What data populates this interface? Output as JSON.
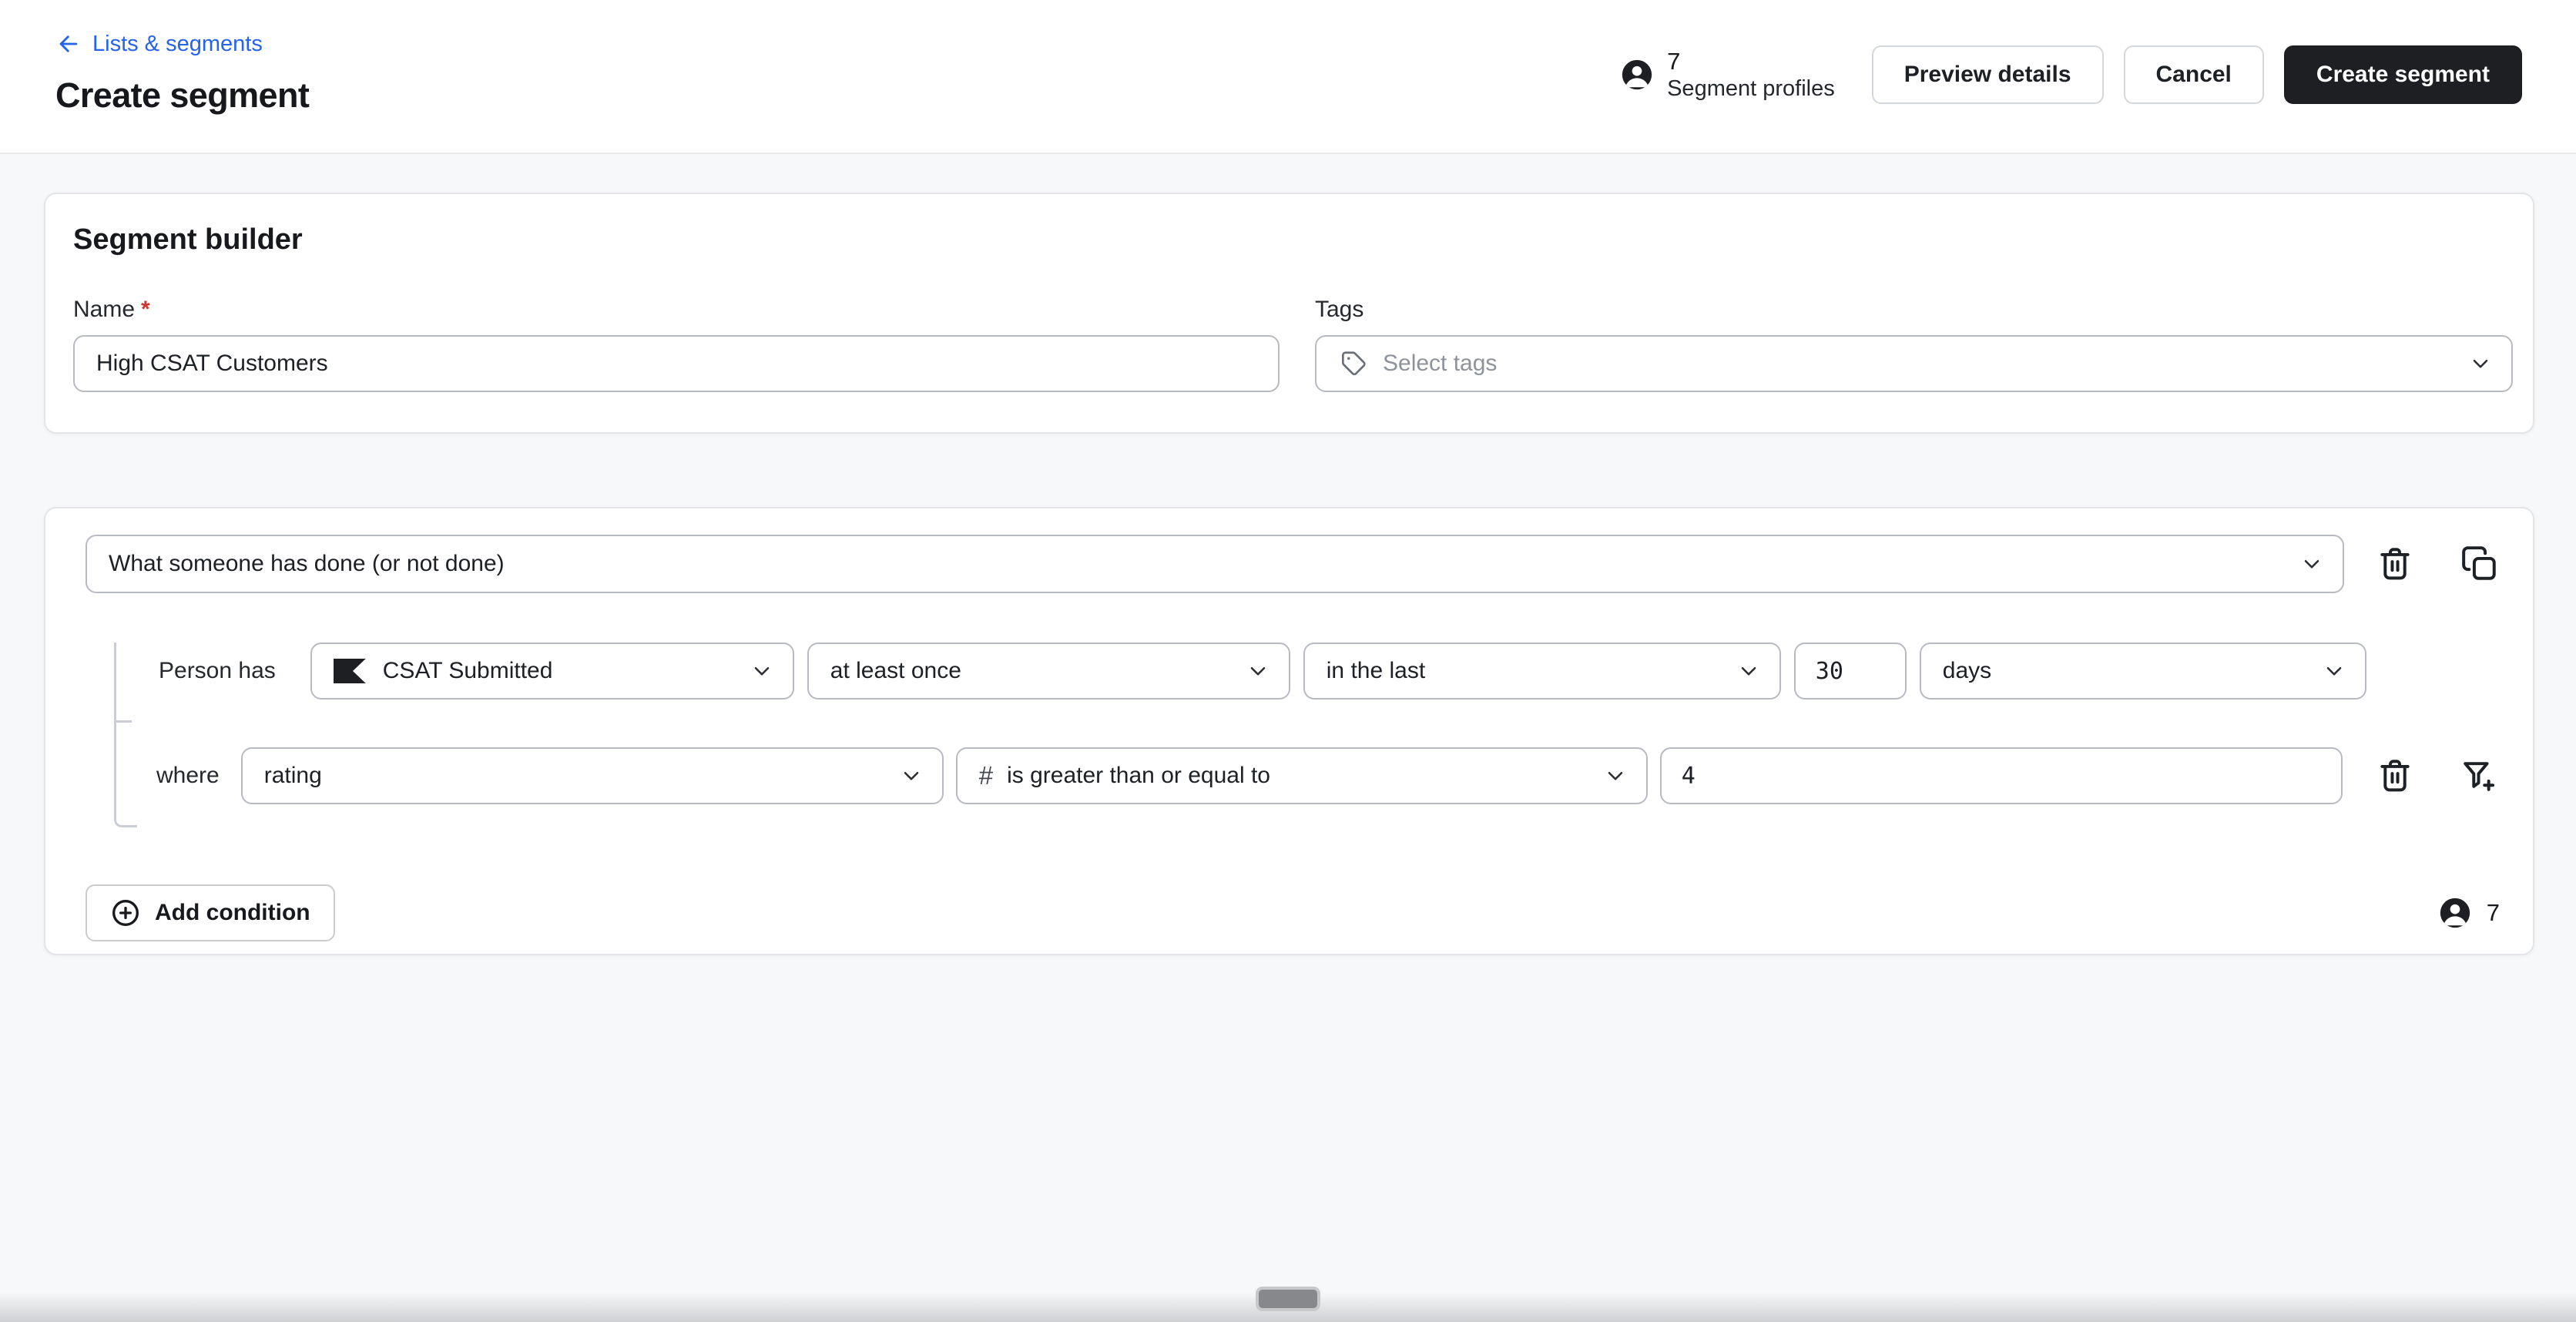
{
  "header": {
    "breadcrumb": "Lists & segments",
    "title": "Create segment",
    "profile_count": "7",
    "profile_label": "Segment profiles",
    "preview_button": "Preview details",
    "cancel_button": "Cancel",
    "create_button": "Create segment"
  },
  "builder": {
    "heading": "Segment builder",
    "name_label": "Name",
    "required_marker": "*",
    "name_value": "High CSAT Customers",
    "tags_label": "Tags",
    "tags_placeholder": "Select tags"
  },
  "condition": {
    "type_value": "What someone has done (or not done)",
    "person_has_label": "Person has",
    "event_value": "CSAT Submitted",
    "frequency_value": "at least once",
    "timeframe_value": "in the last",
    "timeframe_amount": "30",
    "timeframe_unit": "days",
    "where_label": "where",
    "property_value": "rating",
    "operator_prefix": "#",
    "operator_value": "is greater than or equal to",
    "value_amount": "4",
    "add_condition_button": "Add condition",
    "profile_count": "7"
  },
  "colors": {
    "link_blue": "#2563eb",
    "button_dark": "#1d1f22",
    "required_red": "#d0342c"
  }
}
